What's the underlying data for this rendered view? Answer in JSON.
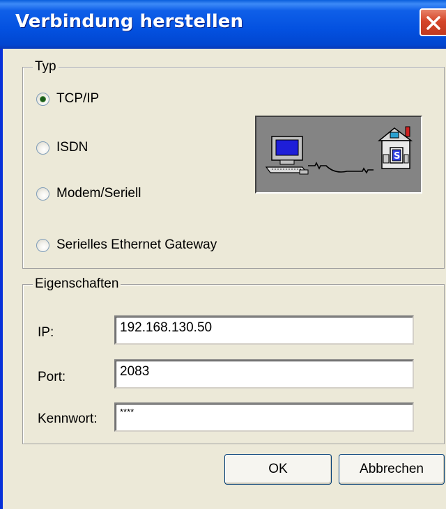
{
  "window": {
    "title": "Verbindung herstellen",
    "close_icon": "close-x-icon",
    "accent": "#0351e0",
    "close_color": "#d5462a"
  },
  "typ_group": {
    "legend": "Typ",
    "options": [
      {
        "label": "TCP/IP",
        "checked": true
      },
      {
        "label": "ISDN",
        "checked": false
      },
      {
        "label": "Modem/Seriell",
        "checked": false
      },
      {
        "label": "Serielles Ethernet Gateway",
        "checked": false
      }
    ],
    "illustration_icon": "pc-to-server-connection-icon"
  },
  "eigenschaften_group": {
    "legend": "Eigenschaften",
    "ip_label": "IP:",
    "ip_value": "192.168.130.50",
    "port_label": "Port:",
    "port_value": "2083",
    "password_label": "Kennwort:",
    "password_value": "****"
  },
  "buttons": {
    "ok": "OK",
    "cancel": "Abbrechen"
  }
}
